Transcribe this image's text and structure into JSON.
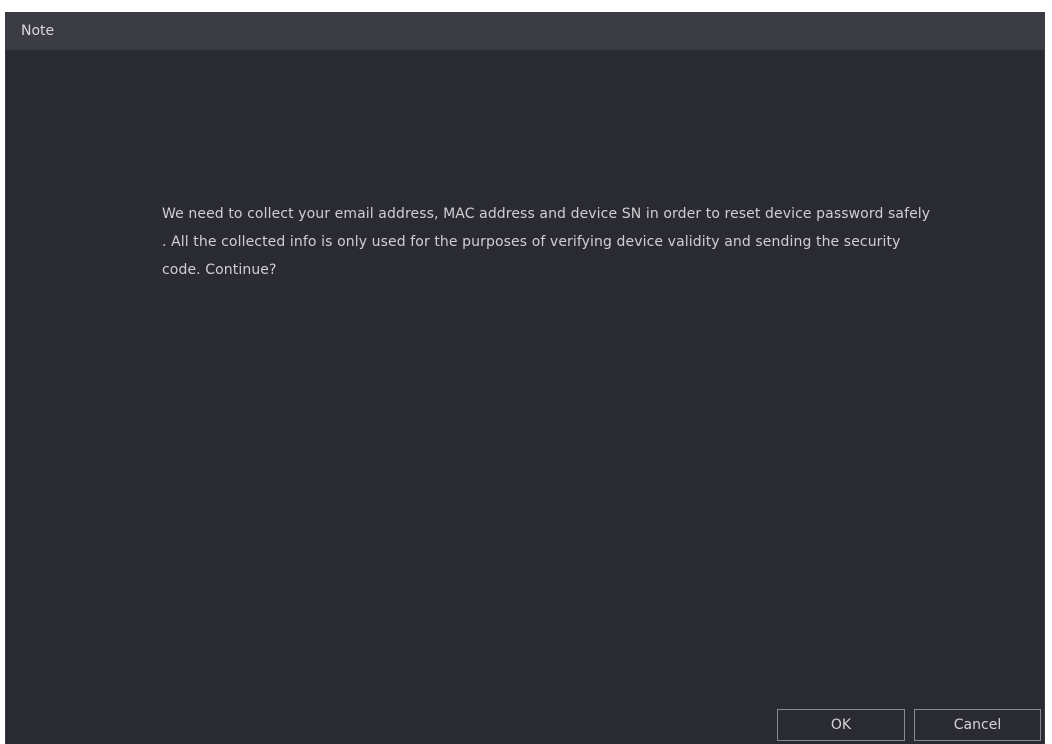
{
  "dialog": {
    "title": "Note",
    "message": "We need to collect your email address, MAC address and device SN in order to reset device password safely . All the collected info is only used for the purposes of verifying device validity and sending the security code. Continue?",
    "ok_label": "OK",
    "cancel_label": "Cancel"
  },
  "colors": {
    "background": "#2a2b32",
    "title_bar": "#3a3b43",
    "text": "#cfcfd3",
    "button_border": "#8a8b92"
  }
}
